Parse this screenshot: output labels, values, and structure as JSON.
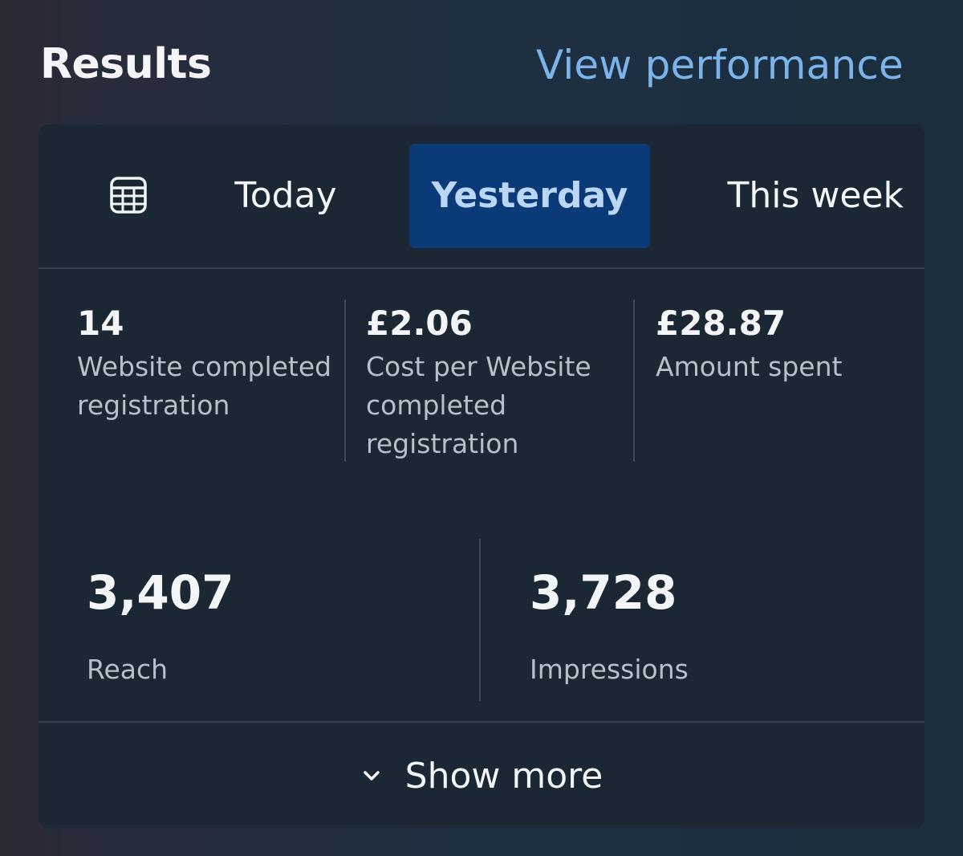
{
  "header": {
    "title": "Results",
    "link": "View performance"
  },
  "tabs": [
    {
      "label": "Today",
      "selected": false
    },
    {
      "label": "Yesterday",
      "selected": true
    },
    {
      "label": "This week",
      "selected": false
    }
  ],
  "icons": {
    "calendar": "calendar-icon",
    "chevron": "chevron-down-icon"
  },
  "metrics_top": [
    {
      "value": "14",
      "label": "Website completed registration"
    },
    {
      "value": "£2.06",
      "label": "Cost per Website completed registration"
    },
    {
      "value": "£28.87",
      "label": "Amount spent"
    }
  ],
  "metrics_bottom": [
    {
      "value": "3,407",
      "label": "Reach"
    },
    {
      "value": "3,728",
      "label": "Impressions"
    }
  ],
  "footer": {
    "show_more": "Show more"
  },
  "colors": {
    "accent_link": "#7cb4ea",
    "selected_tab_bg": "#0a3a78",
    "selected_tab_text": "#bcd6f5",
    "card_bg": "#1b2833"
  }
}
